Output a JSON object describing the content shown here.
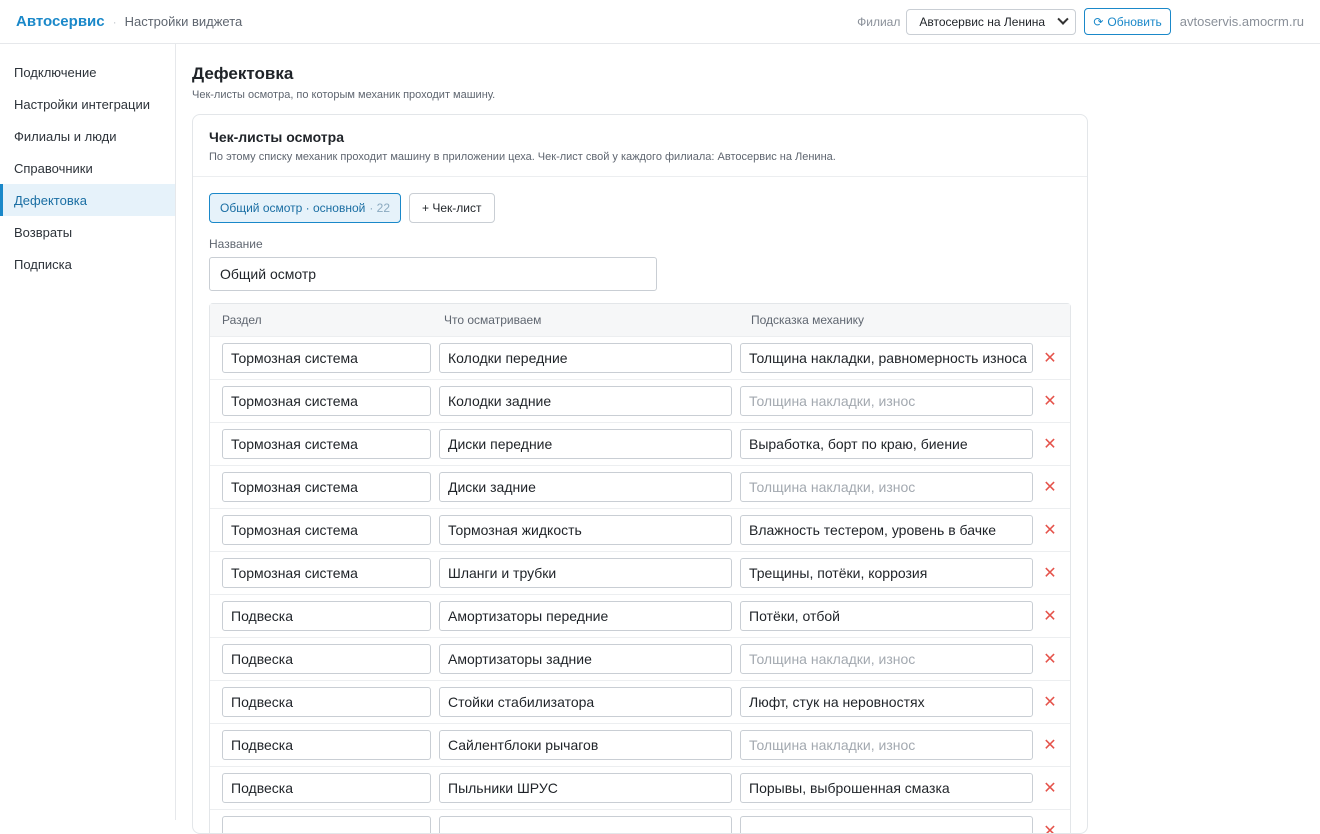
{
  "header": {
    "brand": "Автосервис",
    "separator": "·",
    "subtitle": "Настройки виджета",
    "branch_label": "Филиал",
    "branch_value": "Автосервис на Ленина",
    "refresh_label": "Обновить",
    "domain": "avtoservis.amocrm.ru"
  },
  "sidebar": {
    "items": [
      {
        "label": "Подключение"
      },
      {
        "label": "Настройки интеграции"
      },
      {
        "label": "Филиалы и люди"
      },
      {
        "label": "Справочники"
      },
      {
        "label": "Дефектовка",
        "active": true
      },
      {
        "label": "Возвраты"
      },
      {
        "label": "Подписка"
      }
    ]
  },
  "page": {
    "title": "Дефектовка",
    "subtitle": "Чек-листы осмотра, по которым механик проходит машину."
  },
  "card": {
    "title": "Чек-листы осмотра",
    "description": "По этому списку механик проходит машину в приложении цеха. Чек-лист свой у каждого филиала: Автосервис на Ленина.",
    "active_checklist": "Общий осмотр · основной",
    "active_checklist_count": "· 22",
    "add_checklist_label": "+ Чек-лист",
    "name_label": "Название",
    "name_value": "Общий осмотр"
  },
  "table": {
    "columns": [
      "Раздел",
      "Что осматриваем",
      "Подсказка механику"
    ],
    "rows": [
      {
        "section": "Тормозная система",
        "item": "Колодки передние",
        "hint": "Толщина накладки, равномерность износа",
        "hint_placeholder": false
      },
      {
        "section": "Тормозная система",
        "item": "Колодки задние",
        "hint": "Толщина накладки, износ",
        "hint_placeholder": true
      },
      {
        "section": "Тормозная система",
        "item": "Диски передние",
        "hint": "Выработка, борт по краю, биение",
        "hint_placeholder": false
      },
      {
        "section": "Тормозная система",
        "item": "Диски задние",
        "hint": "Толщина накладки, износ",
        "hint_placeholder": true
      },
      {
        "section": "Тормозная система",
        "item": "Тормозная жидкость",
        "hint": "Влажность тестером, уровень в бачке",
        "hint_placeholder": false
      },
      {
        "section": "Тормозная система",
        "item": "Шланги и трубки",
        "hint": "Трещины, потёки, коррозия",
        "hint_placeholder": false
      },
      {
        "section": "Подвеска",
        "item": "Амортизаторы передние",
        "hint": "Потёки, отбой",
        "hint_placeholder": false
      },
      {
        "section": "Подвеска",
        "item": "Амортизаторы задние",
        "hint": "Толщина накладки, износ",
        "hint_placeholder": true
      },
      {
        "section": "Подвеска",
        "item": "Стойки стабилизатора",
        "hint": "Люфт, стук на неровностях",
        "hint_placeholder": false
      },
      {
        "section": "Подвеска",
        "item": "Сайлентблоки рычагов",
        "hint": "Толщина накладки, износ",
        "hint_placeholder": true
      },
      {
        "section": "Подвеска",
        "item": "Пыльники ШРУС",
        "hint": "Порывы, выброшенная смазка",
        "hint_placeholder": false
      },
      {
        "section": "",
        "item": "",
        "hint": "",
        "hint_placeholder": false
      }
    ],
    "delete_glyph": "✕"
  },
  "colors": {
    "accent": "#1a88c9",
    "delete": "#e5534b"
  }
}
